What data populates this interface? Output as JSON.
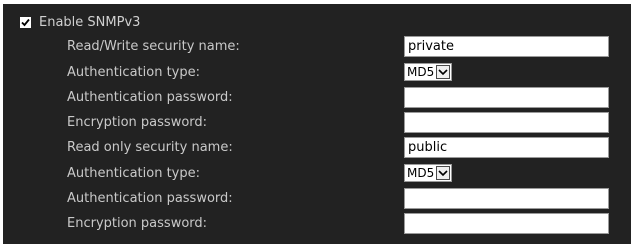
{
  "snmp": {
    "enable_label": "Enable SNMPv3",
    "enable_checked": true
  },
  "rows": [
    {
      "label": "Read/Write security name:",
      "type": "text",
      "value": "private"
    },
    {
      "label": "Authentication type:",
      "type": "select",
      "value": "MD5"
    },
    {
      "label": "Authentication password:",
      "type": "password",
      "value": ""
    },
    {
      "label": "Encryption password:",
      "type": "password",
      "value": ""
    },
    {
      "label": "Read only security name:",
      "type": "text",
      "value": "public"
    },
    {
      "label": "Authentication type:",
      "type": "select",
      "value": "MD5"
    },
    {
      "label": "Authentication password:",
      "type": "password",
      "value": ""
    },
    {
      "label": "Encryption password:",
      "type": "password",
      "value": ""
    }
  ]
}
